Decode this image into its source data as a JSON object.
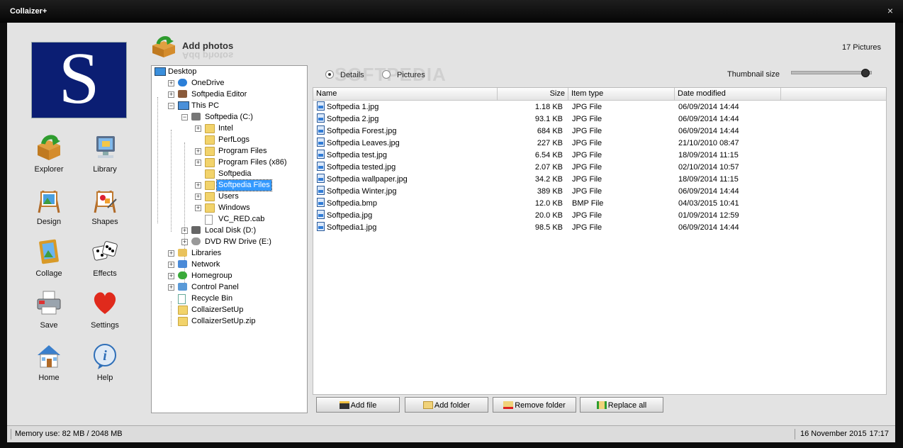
{
  "window": {
    "title": "Collaizer+",
    "close_glyph": "×"
  },
  "logo": {
    "letter": "S"
  },
  "nav": [
    {
      "label": "Explorer",
      "icon": "explorer-box-icon"
    },
    {
      "label": "Library",
      "icon": "library-monitor-icon"
    },
    {
      "label": "Design",
      "icon": "design-easel-icon"
    },
    {
      "label": "Shapes",
      "icon": "shapes-easel-icon"
    },
    {
      "label": "Collage",
      "icon": "collage-frame-icon"
    },
    {
      "label": "Effects",
      "icon": "effects-dice-icon"
    },
    {
      "label": "Save",
      "icon": "save-printer-icon"
    },
    {
      "label": "Settings",
      "icon": "settings-heart-icon"
    },
    {
      "label": "Home",
      "icon": "home-house-icon"
    },
    {
      "label": "Help",
      "icon": "help-info-icon"
    }
  ],
  "header": {
    "title": "Add photos",
    "count": "17 Pictures"
  },
  "tree": [
    {
      "label": "Desktop",
      "expander": "",
      "icon": "desktop"
    },
    {
      "label": "OneDrive",
      "expander": "+",
      "icon": "cloud"
    },
    {
      "label": "Softpedia Editor",
      "expander": "+",
      "icon": "user"
    },
    {
      "label": "This PC",
      "expander": "−",
      "icon": "pc"
    },
    {
      "label": "Softpedia (C:)",
      "expander": "−",
      "icon": "drive-c"
    },
    {
      "label": "Intel",
      "expander": "+",
      "icon": "folder"
    },
    {
      "label": "PerfLogs",
      "expander": "",
      "icon": "folder"
    },
    {
      "label": "Program Files",
      "expander": "+",
      "icon": "folder"
    },
    {
      "label": "Program Files (x86)",
      "expander": "+",
      "icon": "folder"
    },
    {
      "label": "Softpedia",
      "expander": "",
      "icon": "folder"
    },
    {
      "label": "Softpedia Files",
      "expander": "+",
      "icon": "folder",
      "selected": true
    },
    {
      "label": "Users",
      "expander": "+",
      "icon": "folder"
    },
    {
      "label": "Windows",
      "expander": "+",
      "icon": "folder"
    },
    {
      "label": "VC_RED.cab",
      "expander": "",
      "icon": "file"
    },
    {
      "label": "Local Disk (D:)",
      "expander": "+",
      "icon": "drive"
    },
    {
      "label": "DVD RW Drive (E:)",
      "expander": "+",
      "icon": "dvd"
    },
    {
      "label": "Libraries",
      "expander": "+",
      "icon": "libraries"
    },
    {
      "label": "Network",
      "expander": "+",
      "icon": "network"
    },
    {
      "label": "Homegroup",
      "expander": "+",
      "icon": "homegroup"
    },
    {
      "label": "Control Panel",
      "expander": "+",
      "icon": "control-panel"
    },
    {
      "label": "Recycle Bin",
      "expander": "",
      "icon": "recycle"
    },
    {
      "label": "CollaizerSetUp",
      "expander": "",
      "icon": "folder"
    },
    {
      "label": "CollaizerSetUp.zip",
      "expander": "",
      "icon": "zip"
    }
  ],
  "view": {
    "details_label": "Details",
    "pictures_label": "Pictures",
    "selected": "details",
    "thumbnail_label": "Thumbnail size",
    "thumbnail_level": 0.9,
    "watermark": "SOFTPEDIA"
  },
  "columns": [
    "Name",
    "Size",
    "Item type",
    "Date modified"
  ],
  "files": [
    {
      "name": "Softpedia 1.jpg",
      "size": "1.18 KB",
      "type": "JPG File",
      "date": "06/09/2014 14:44"
    },
    {
      "name": "Softpedia 2.jpg",
      "size": "93.1 KB",
      "type": "JPG File",
      "date": "06/09/2014 14:44"
    },
    {
      "name": "Softpedia Forest.jpg",
      "size": "684 KB",
      "type": "JPG File",
      "date": "06/09/2014 14:44"
    },
    {
      "name": "Softpedia Leaves.jpg",
      "size": "227 KB",
      "type": "JPG File",
      "date": "21/10/2010 08:47"
    },
    {
      "name": "Softpedia test.jpg",
      "size": "6.54 KB",
      "type": "JPG File",
      "date": "18/09/2014 11:15"
    },
    {
      "name": "Softpedia tested.jpg",
      "size": "2.07 KB",
      "type": "JPG File",
      "date": "02/10/2014 10:57"
    },
    {
      "name": "Softpedia wallpaper.jpg",
      "size": "34.2 KB",
      "type": "JPG File",
      "date": "18/09/2014 11:15"
    },
    {
      "name": "Softpedia Winter.jpg",
      "size": "389 KB",
      "type": "JPG File",
      "date": "06/09/2014 14:44"
    },
    {
      "name": "Softpedia.bmp",
      "size": "12.0 KB",
      "type": "BMP File",
      "date": "04/03/2015 10:41"
    },
    {
      "name": "Softpedia.jpg",
      "size": "20.0 KB",
      "type": "JPG File",
      "date": "01/09/2014 12:59"
    },
    {
      "name": "Softpedia1.jpg",
      "size": "98.5 KB",
      "type": "JPG File",
      "date": "06/09/2014 14:44"
    }
  ],
  "buttons": {
    "add_file": "Add file",
    "add_folder": "Add folder",
    "remove_folder": "Remove folder",
    "replace_all": "Replace all"
  },
  "status": {
    "memory": "Memory use: 82 MB / 2048 MB",
    "date": "16 November 2015",
    "time": "17:17"
  }
}
